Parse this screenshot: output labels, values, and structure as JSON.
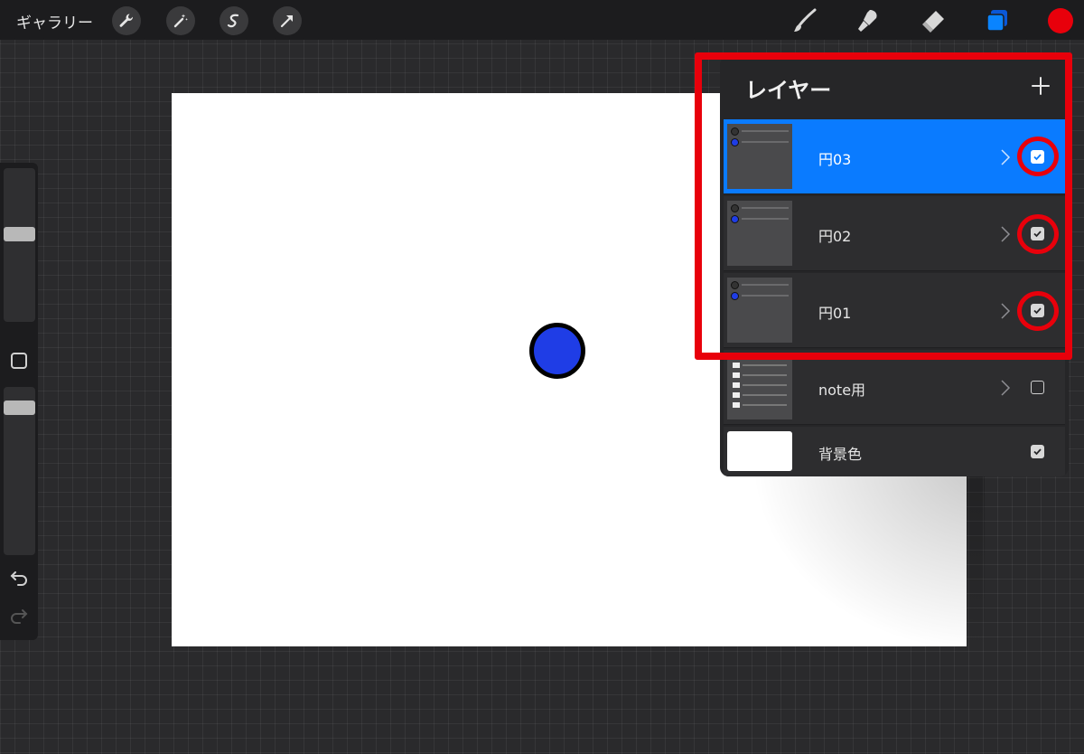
{
  "topbar": {
    "gallery_label": "ギャラリー",
    "left_tools": [
      "wrench-icon",
      "magic-wand-icon",
      "selection-icon",
      "transform-arrow-icon"
    ],
    "right_tools": [
      "brush-icon",
      "smudge-icon",
      "eraser-icon",
      "layers-icon"
    ],
    "current_color": "#e8000b",
    "layers_active_color": "#0a84ff"
  },
  "canvas": {
    "background": "#ffffff",
    "circle_fill": "#1f3de6",
    "circle_stroke": "#000000"
  },
  "panel": {
    "title": "レイヤー",
    "add_symbol": "+",
    "layers": [
      {
        "name": "円03",
        "selected": true,
        "visible": true
      },
      {
        "name": "円02",
        "selected": false,
        "visible": true
      },
      {
        "name": "円01",
        "selected": false,
        "visible": true
      },
      {
        "name": "note用",
        "selected": false,
        "visible": false
      },
      {
        "name": "背景色",
        "selected": false,
        "visible": true
      }
    ]
  },
  "annotation": {
    "color": "#e8000b"
  }
}
